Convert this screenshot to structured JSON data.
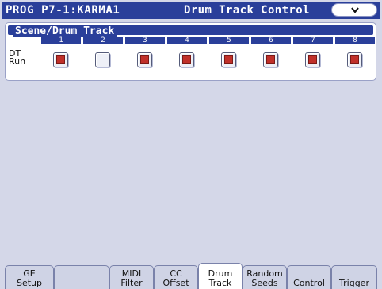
{
  "title": {
    "left": "PROG P7-1:KARMA1",
    "right": "Drum Track Control"
  },
  "menu": {
    "icon": "chevron-down-icon"
  },
  "panel": {
    "title": "Scene/Drum Track",
    "row_label_1": "DT",
    "row_label_2": "Run",
    "columns": [
      "1",
      "2",
      "3",
      "4",
      "5",
      "6",
      "7",
      "8"
    ],
    "checked": [
      true,
      false,
      true,
      true,
      true,
      true,
      true,
      true
    ]
  },
  "tabs": [
    {
      "label": "GE\nSetup",
      "active": false
    },
    {
      "label": "",
      "active": false
    },
    {
      "label": "MIDI\nFilter",
      "active": false
    },
    {
      "label": "CC\nOffset",
      "active": false
    },
    {
      "label": "Drum\nTrack",
      "active": true
    },
    {
      "label": "Random\nSeeds",
      "active": false
    },
    {
      "label": "Control",
      "active": false
    },
    {
      "label": "Trigger",
      "active": false
    }
  ],
  "colors": {
    "title_bar": "#2a3f9a",
    "screen_bg": "#d4d7e8",
    "checkbox_fill": "#c0302a"
  }
}
